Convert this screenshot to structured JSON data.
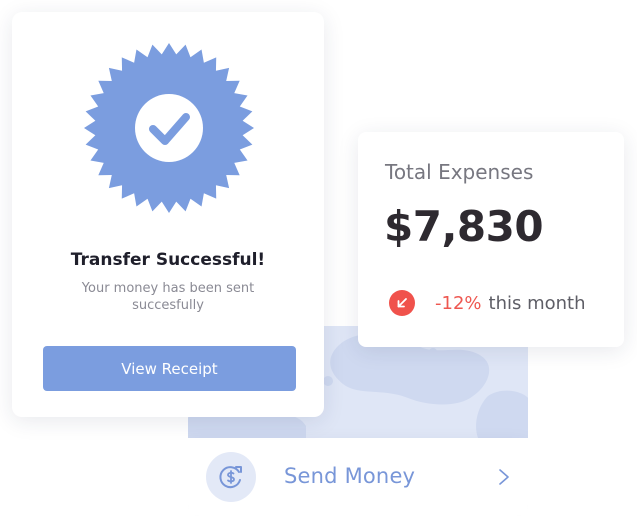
{
  "success": {
    "title": "Transfer Successful!",
    "subtitle": "Your money has been sent succesfully",
    "button_label": "View Receipt",
    "badge_color": "#7b9ddf"
  },
  "expenses": {
    "title": "Total Expenses",
    "amount": "$7,830",
    "change_percent": "-12%",
    "change_suffix": "this month",
    "trend_color": "#f0524c"
  },
  "send": {
    "label": "Send Money",
    "icon": "dollar-transfer-icon",
    "chevron_icon": "chevron-right-icon"
  }
}
